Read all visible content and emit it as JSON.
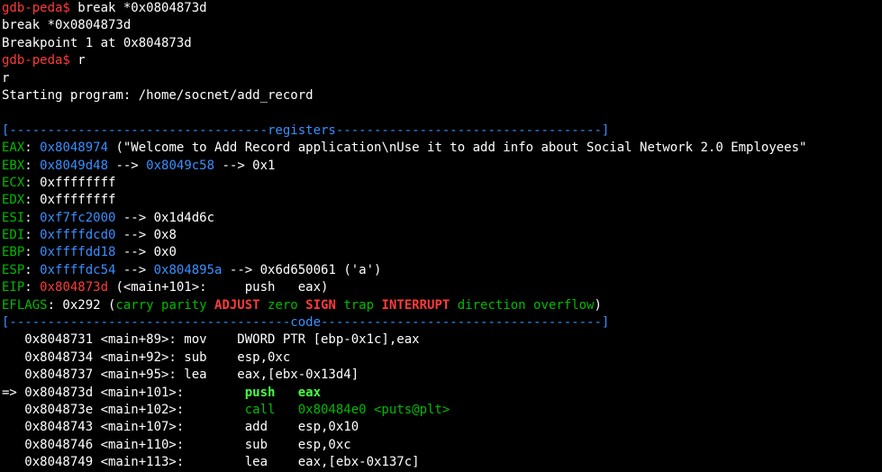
{
  "colors": {
    "background": "#000000",
    "text": "#ffffff",
    "prompt_red": "#ff3a3a",
    "label_green": "#00bb00",
    "bright_green": "#44ff44",
    "address_blue": "#3a8fff"
  },
  "lines": [
    [
      {
        "t": "gdb-peda$ ",
        "c": "r"
      },
      {
        "t": "break *0x0804873d",
        "c": "w"
      }
    ],
    [
      {
        "t": "break *0x0804873d",
        "c": "w"
      }
    ],
    [
      {
        "t": "Breakpoint 1 at 0x804873d",
        "c": "w"
      }
    ],
    [
      {
        "t": "gdb-peda$ ",
        "c": "r"
      },
      {
        "t": "r",
        "c": "w"
      }
    ],
    [
      {
        "t": "r",
        "c": "w"
      }
    ],
    [
      {
        "t": "Starting program: /home/socnet/add_record",
        "c": "w"
      }
    ],
    [
      {
        "t": "",
        "c": "w"
      }
    ],
    [
      {
        "t": "[----------------------------------registers-----------------------------------]",
        "c": "b"
      }
    ],
    [
      {
        "t": "EAX",
        "c": "g"
      },
      {
        "t": ": ",
        "c": "w"
      },
      {
        "t": "0x8048974",
        "c": "b"
      },
      {
        "t": " (\"Welcome to Add Record application\\nUse it to add info about Social Network 2.0 Employees\"",
        "c": "w"
      }
    ],
    [
      {
        "t": "EBX",
        "c": "g"
      },
      {
        "t": ": ",
        "c": "w"
      },
      {
        "t": "0x8049d48",
        "c": "b"
      },
      {
        "t": " --> ",
        "c": "w"
      },
      {
        "t": "0x8049c58",
        "c": "b"
      },
      {
        "t": " --> 0x1",
        "c": "w"
      }
    ],
    [
      {
        "t": "ECX",
        "c": "g"
      },
      {
        "t": ": 0xffffffff",
        "c": "w"
      }
    ],
    [
      {
        "t": "EDX",
        "c": "g"
      },
      {
        "t": ": 0xffffffff",
        "c": "w"
      }
    ],
    [
      {
        "t": "ESI",
        "c": "g"
      },
      {
        "t": ": ",
        "c": "w"
      },
      {
        "t": "0xf7fc2000",
        "c": "b"
      },
      {
        "t": " --> 0x1d4d6c",
        "c": "w"
      }
    ],
    [
      {
        "t": "EDI",
        "c": "g"
      },
      {
        "t": ": ",
        "c": "w"
      },
      {
        "t": "0xffffdcd0",
        "c": "b"
      },
      {
        "t": " --> 0x8",
        "c": "w"
      }
    ],
    [
      {
        "t": "EBP",
        "c": "g"
      },
      {
        "t": ": ",
        "c": "w"
      },
      {
        "t": "0xffffdd18",
        "c": "b"
      },
      {
        "t": " --> 0x0",
        "c": "w"
      }
    ],
    [
      {
        "t": "ESP",
        "c": "g"
      },
      {
        "t": ": ",
        "c": "w"
      },
      {
        "t": "0xffffdc54",
        "c": "b"
      },
      {
        "t": " --> ",
        "c": "w"
      },
      {
        "t": "0x804895a",
        "c": "b"
      },
      {
        "t": " --> 0x6d650061 ('a')",
        "c": "w"
      }
    ],
    [
      {
        "t": "EIP",
        "c": "g"
      },
      {
        "t": ": ",
        "c": "w"
      },
      {
        "t": "0x804873d",
        "c": "r"
      },
      {
        "t": " (<main+101>:     push   eax)",
        "c": "w"
      }
    ],
    [
      {
        "t": "EFLAGS",
        "c": "g"
      },
      {
        "t": ": 0x292 (",
        "c": "w"
      },
      {
        "t": "carry parity ",
        "c": "g"
      },
      {
        "t": "ADJUST",
        "c": "rb"
      },
      {
        "t": " zero ",
        "c": "g"
      },
      {
        "t": "SIGN",
        "c": "rb"
      },
      {
        "t": " trap ",
        "c": "g"
      },
      {
        "t": "INTERRUPT",
        "c": "rb"
      },
      {
        "t": " direction overflow",
        "c": "g"
      },
      {
        "t": ")",
        "c": "w"
      }
    ],
    [
      {
        "t": "[-------------------------------------code-------------------------------------]",
        "c": "b"
      }
    ],
    [
      {
        "t": "   0x8048731 <main+89>: mov    DWORD PTR [ebp-0x1c],eax",
        "c": "w"
      }
    ],
    [
      {
        "t": "   0x8048734 <main+92>: sub    esp,0xc",
        "c": "w"
      }
    ],
    [
      {
        "t": "   0x8048737 <main+95>: lea    eax,[ebx-0x13d4]",
        "c": "w"
      }
    ],
    [
      {
        "t": "=> 0x804873d <main+101>:        ",
        "c": "w"
      },
      {
        "t": "push   eax",
        "c": "gb"
      }
    ],
    [
      {
        "t": "   0x804873e <main+102>:        ",
        "c": "w"
      },
      {
        "t": "call   0x80484e0 <puts@plt>",
        "c": "g"
      }
    ],
    [
      {
        "t": "   0x8048743 <main+107>:        add    esp,0x10",
        "c": "w"
      }
    ],
    [
      {
        "t": "   0x8048746 <main+110>:        sub    esp,0xc",
        "c": "w"
      }
    ],
    [
      {
        "t": "   0x8048749 <main+113>:        lea    eax,[ebx-0x137c]",
        "c": "w"
      }
    ]
  ]
}
